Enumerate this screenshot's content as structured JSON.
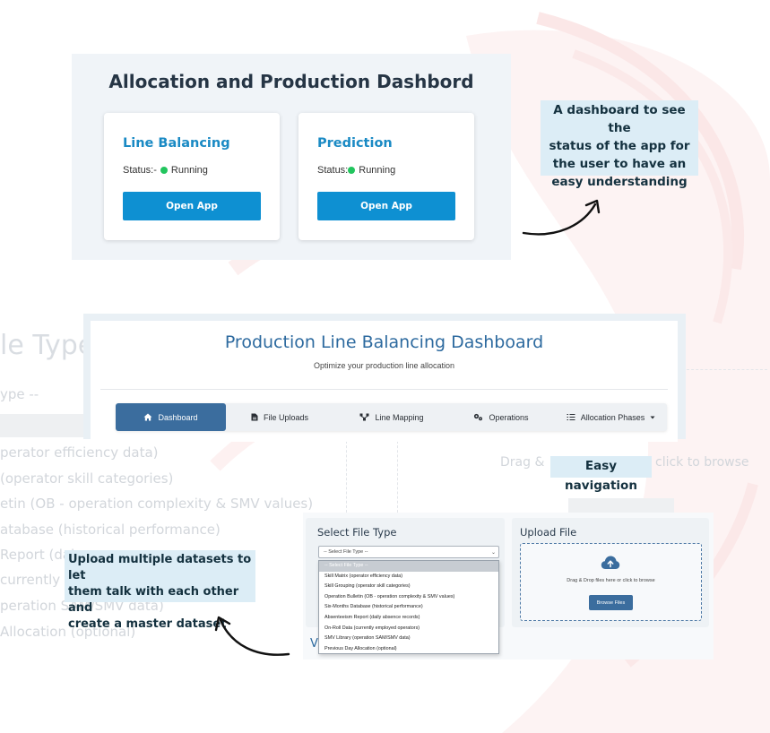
{
  "allocation_dashboard": {
    "title": "Allocation and Production Dashbord",
    "apps": [
      {
        "name": "Line Balancing",
        "status_label": "Status:-",
        "status": "Running",
        "button": "Open App"
      },
      {
        "name": "Prediction",
        "status_label": "Status:",
        "status": "Running",
        "button": "Open App"
      }
    ],
    "status_color": "#22c55e",
    "accent_color": "#0e90d2"
  },
  "callouts": {
    "dashboard": [
      "A dashboard to see the",
      "status of the app for",
      "the user to have an",
      "easy understanding"
    ],
    "navigation": "Easy navigation",
    "upload": [
      "Upload multiple datasets to let",
      "them talk with each other and",
      "create a master dataset"
    ]
  },
  "production_dashboard": {
    "title": "Production Line Balancing Dashboard",
    "subtitle": "Optimize your production line allocation",
    "nav": [
      {
        "label": "Dashboard",
        "icon": "home-icon",
        "active": true
      },
      {
        "label": "File Uploads",
        "icon": "file-icon",
        "active": false
      },
      {
        "label": "Line Mapping",
        "icon": "network-icon",
        "active": false
      },
      {
        "label": "Operations",
        "icon": "gears-icon",
        "active": false
      },
      {
        "label": "Allocation Phases",
        "icon": "list-icon",
        "active": false,
        "has_dropdown": true
      }
    ],
    "nav_active_color": "#3b6d9e"
  },
  "upload_panel": {
    "file_type_title": "Select File Type",
    "select_placeholder": "-- Select File Type --",
    "options": [
      "-- Select File Type --",
      "Skill Matrix (operator efficiency data)",
      "Skill Grouping (operator skill categories)",
      "Operation Bulletin (OB - operation complexity & SMV values)",
      "Six-Months Database (historical performance)",
      "Absenteeism Report (daily absence records)",
      "On-Roll Data (currently employed operators)",
      "SMV Library (operation SAM/SMV data)",
      "Previous Day Allocation (optional)"
    ],
    "upload_title": "Upload File",
    "drop_text": "Drag & Drop files here or click to browse",
    "browse_button": "Browse Files"
  },
  "background_ghost": {
    "big_title": "le Type",
    "select_hint": "ype --",
    "partial_letter": "V",
    "drag_hint_left": "Drag &",
    "drag_hint_right": "click to browse",
    "lines": [
      "perator efficiency data)",
      "(operator skill categories)",
      "etin (OB - operation complexity & SMV values)",
      "atabase (historical performance)",
      "Report (dai",
      "currently e",
      "peration SAM/SMV data)",
      "Allocation (optional)"
    ]
  }
}
